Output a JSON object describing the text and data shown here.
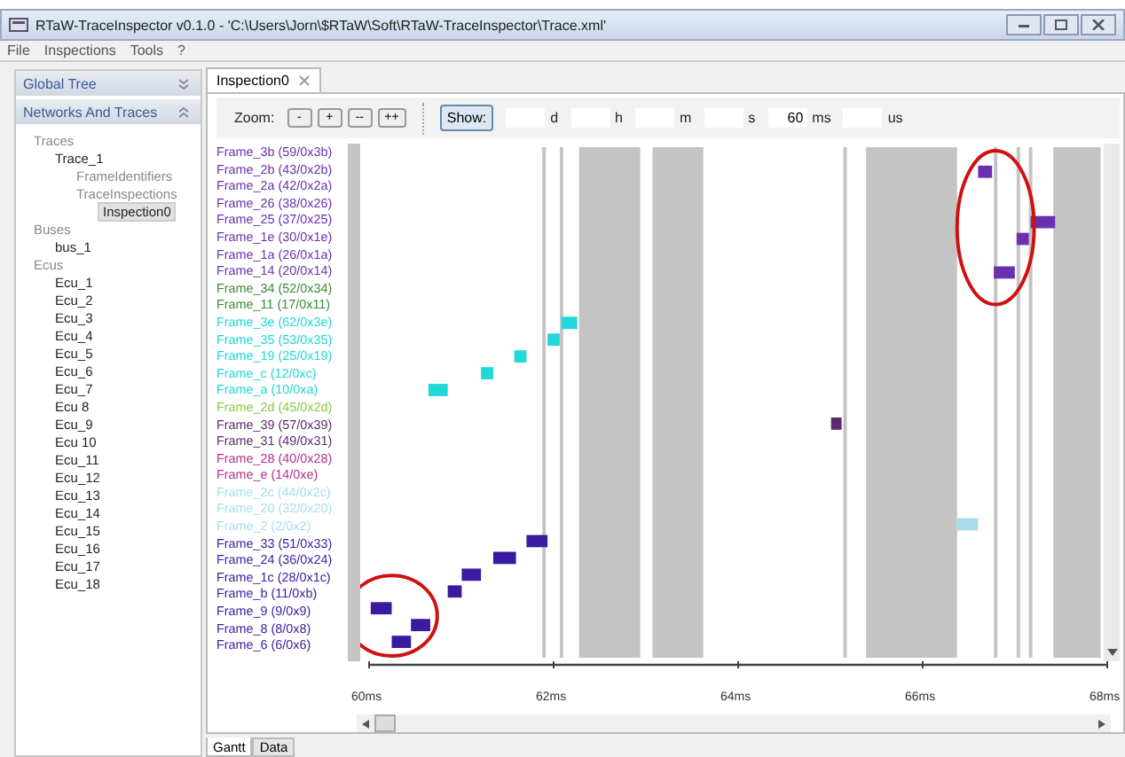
{
  "window": {
    "title": "RTaW-TraceInspector v0.1.0 - 'C:\\Users\\Jorn\\$RTaW\\Soft\\RTaW-TraceInspector\\Trace.xml'"
  },
  "menu": [
    "File",
    "Inspections",
    "Tools",
    "?"
  ],
  "sidebar": {
    "panels": [
      {
        "label": "Global Tree",
        "expanded": false
      },
      {
        "label": "Networks And Traces",
        "expanded": true
      }
    ],
    "tree": [
      {
        "label": "Traces",
        "kind": "group",
        "selected": false,
        "children": [
          {
            "label": "Trace_1",
            "kind": "item",
            "selected": false,
            "children": [
              {
                "label": "FrameIdentifiers",
                "kind": "group",
                "selected": false
              },
              {
                "label": "TraceInspections",
                "kind": "group",
                "selected": false,
                "children": [
                  {
                    "label": "Inspection0",
                    "kind": "item",
                    "selected": true
                  }
                ]
              }
            ]
          }
        ]
      },
      {
        "label": "Buses",
        "kind": "group",
        "selected": false,
        "children": [
          {
            "label": "bus_1",
            "kind": "item",
            "selected": false
          }
        ]
      },
      {
        "label": "Ecus",
        "kind": "group",
        "selected": false,
        "children": [
          {
            "label": "Ecu_1",
            "kind": "item",
            "selected": false
          },
          {
            "label": "Ecu_2",
            "kind": "item",
            "selected": false
          },
          {
            "label": "Ecu_3",
            "kind": "item",
            "selected": false
          },
          {
            "label": "Ecu_4",
            "kind": "item",
            "selected": false
          },
          {
            "label": "Ecu_5",
            "kind": "item",
            "selected": false
          },
          {
            "label": "Ecu_6",
            "kind": "item",
            "selected": false
          },
          {
            "label": "Ecu_7",
            "kind": "item",
            "selected": false
          },
          {
            "label": "Ecu 8",
            "kind": "item",
            "selected": false
          },
          {
            "label": "Ecu_9",
            "kind": "item",
            "selected": false
          },
          {
            "label": "Ecu 10",
            "kind": "item",
            "selected": false
          },
          {
            "label": "Ecu_11",
            "kind": "item",
            "selected": false
          },
          {
            "label": "Ecu_12",
            "kind": "item",
            "selected": false
          },
          {
            "label": "Ecu_13",
            "kind": "item",
            "selected": false
          },
          {
            "label": "Ecu_14",
            "kind": "item",
            "selected": false
          },
          {
            "label": "Ecu_15",
            "kind": "item",
            "selected": false
          },
          {
            "label": "Ecu_16",
            "kind": "item",
            "selected": false
          },
          {
            "label": "Ecu_17",
            "kind": "item",
            "selected": false
          },
          {
            "label": "Ecu_18",
            "kind": "item",
            "selected": false
          }
        ]
      }
    ]
  },
  "tabs": [
    {
      "label": "Inspection0",
      "selected": true
    }
  ],
  "toolbar": {
    "zoom_label": "Zoom:",
    "zoom_buttons": [
      "-",
      "+",
      "--",
      "++"
    ],
    "show_button": "Show:",
    "time_fields": [
      {
        "unit": "d"
      },
      {
        "unit": "h"
      },
      {
        "unit": "m"
      },
      {
        "unit": "s"
      },
      {
        "value": "60",
        "unit": "ms"
      },
      {
        "unit": "us"
      }
    ]
  },
  "frames": [
    {
      "label": "Frame_3b (59/0x3b)",
      "color": "#6a30b0"
    },
    {
      "label": "Frame_2b (43/0x2b)",
      "color": "#6a30b0"
    },
    {
      "label": "Frame_2a (42/0x2a)",
      "color": "#6a30b0"
    },
    {
      "label": "Frame_26 (38/0x26)",
      "color": "#6a30b0"
    },
    {
      "label": "Frame_25 (37/0x25)",
      "color": "#6a30b0"
    },
    {
      "label": "Frame_1e (30/0x1e)",
      "color": "#6a30b0"
    },
    {
      "label": "Frame_1a (26/0x1a)",
      "color": "#6a30b0"
    },
    {
      "label": "Frame_14 (20/0x14)",
      "color": "#6a30b0"
    },
    {
      "label": "Frame_34 (52/0x34)",
      "color": "#3a8a3a"
    },
    {
      "label": "Frame_11 (17/0x11)",
      "color": "#3a8a3a"
    },
    {
      "label": "Frame_3e (62/0x3e)",
      "color": "#20d8d8"
    },
    {
      "label": "Frame_35 (53/0x35)",
      "color": "#20d8d8"
    },
    {
      "label": "Frame_19 (25/0x19)",
      "color": "#20d8d8"
    },
    {
      "label": "Frame_c (12/0xc)",
      "color": "#20d8d8"
    },
    {
      "label": "Frame_a (10/0xa)",
      "color": "#20d8d8"
    },
    {
      "label": "Frame_2d (45/0x2d)",
      "color": "#88cc44"
    },
    {
      "label": "Frame_39 (57/0x39)",
      "color": "#5a2a6a"
    },
    {
      "label": "Frame_31 (49/0x31)",
      "color": "#5a2a6a"
    },
    {
      "label": "Frame_28 (40/0x28)",
      "color": "#b03090"
    },
    {
      "label": "Frame_e (14/0xe)",
      "color": "#b03090"
    },
    {
      "label": "Frame_2c (44/0x2c)",
      "color": "#a8dcec"
    },
    {
      "label": "Frame_20 (32/0x20)",
      "color": "#a8dcec"
    },
    {
      "label": "Frame_2 (2/0x2)",
      "color": "#a8dcec"
    },
    {
      "label": "Frame_33 (51/0x33)",
      "color": "#3a1aa0"
    },
    {
      "label": "Frame_24 (36/0x24)",
      "color": "#3a1aa0"
    },
    {
      "label": "Frame_1c (28/0x1c)",
      "color": "#3a1aa0"
    },
    {
      "label": "Frame_b (11/0xb)",
      "color": "#3a1aa0"
    },
    {
      "label": "Frame_9 (9/0x9)",
      "color": "#3a1aa0"
    },
    {
      "label": "Frame_8 (8/0x8)",
      "color": "#3a1aa0"
    },
    {
      "label": "Frame_6 (6/0x6)",
      "color": "#3a1aa0"
    }
  ],
  "time_axis": [
    "60ms",
    "62ms",
    "64ms",
    "66ms",
    "68ms"
  ],
  "bottom_tabs": [
    {
      "label": "Gantt",
      "selected": true
    },
    {
      "label": "Data",
      "selected": false
    }
  ]
}
